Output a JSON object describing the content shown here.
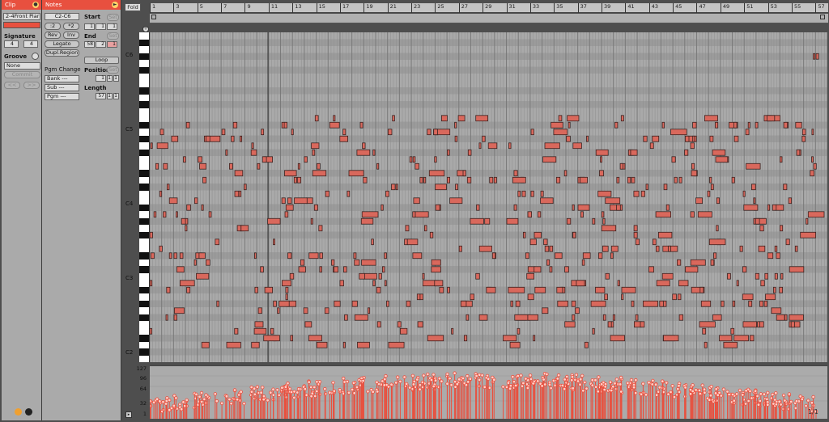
{
  "clip": {
    "header": "Clip",
    "name": "2-4Front Piar",
    "signature_label": "Signature",
    "sig_num": "4",
    "sig_den": "4",
    "groove_label": "Groove",
    "groove_value": "None",
    "commit_label": "Commit",
    "nudge_back": "<<",
    "nudge_fwd": ">>"
  },
  "notes": {
    "header": "Notes",
    "range": "C2-C6",
    "half_label": ":2",
    "double_label": "*2",
    "rev_label": "Rev",
    "inv_label": "Inv",
    "legato_label": "Legato",
    "dupl_label": "Dupl.Region",
    "pgm_change_label": "Pgm Change",
    "bank_label": "Bank ---",
    "sub_label": "Sub ---",
    "pgm_label": "Pgm ---",
    "start_label": "Start",
    "end_label": "End",
    "set_label": "Set",
    "loop_label": "Loop",
    "position_label": "Position",
    "length_label": "Length",
    "start_vals": [
      "1",
      "1",
      "1"
    ],
    "end_vals": [
      "58",
      "2",
      "1"
    ],
    "position_vals": [
      "1",
      "1",
      "1"
    ],
    "length_vals": [
      "57",
      "1",
      "1"
    ]
  },
  "editor": {
    "fold_label": "Fold",
    "ruler_bars": [
      "1",
      "3",
      "5",
      "7",
      "9",
      "11",
      "13",
      "15",
      "17",
      "19",
      "21",
      "23",
      "25",
      "27",
      "29",
      "31",
      "33",
      "35",
      "37",
      "39",
      "41",
      "43",
      "45",
      "47",
      "49",
      "51",
      "53",
      "55",
      "57"
    ],
    "octave_labels": [
      "C6",
      "C5",
      "C4",
      "C3",
      "C2"
    ],
    "velocity_ticks": [
      "127",
      "96",
      "64",
      "32",
      "1"
    ],
    "page_indicator": "1/1"
  },
  "colors": {
    "accent": "#e8503f",
    "note_fill": "#d9685c",
    "note_border": "#3a2220",
    "velocity": "#e8503f"
  }
}
